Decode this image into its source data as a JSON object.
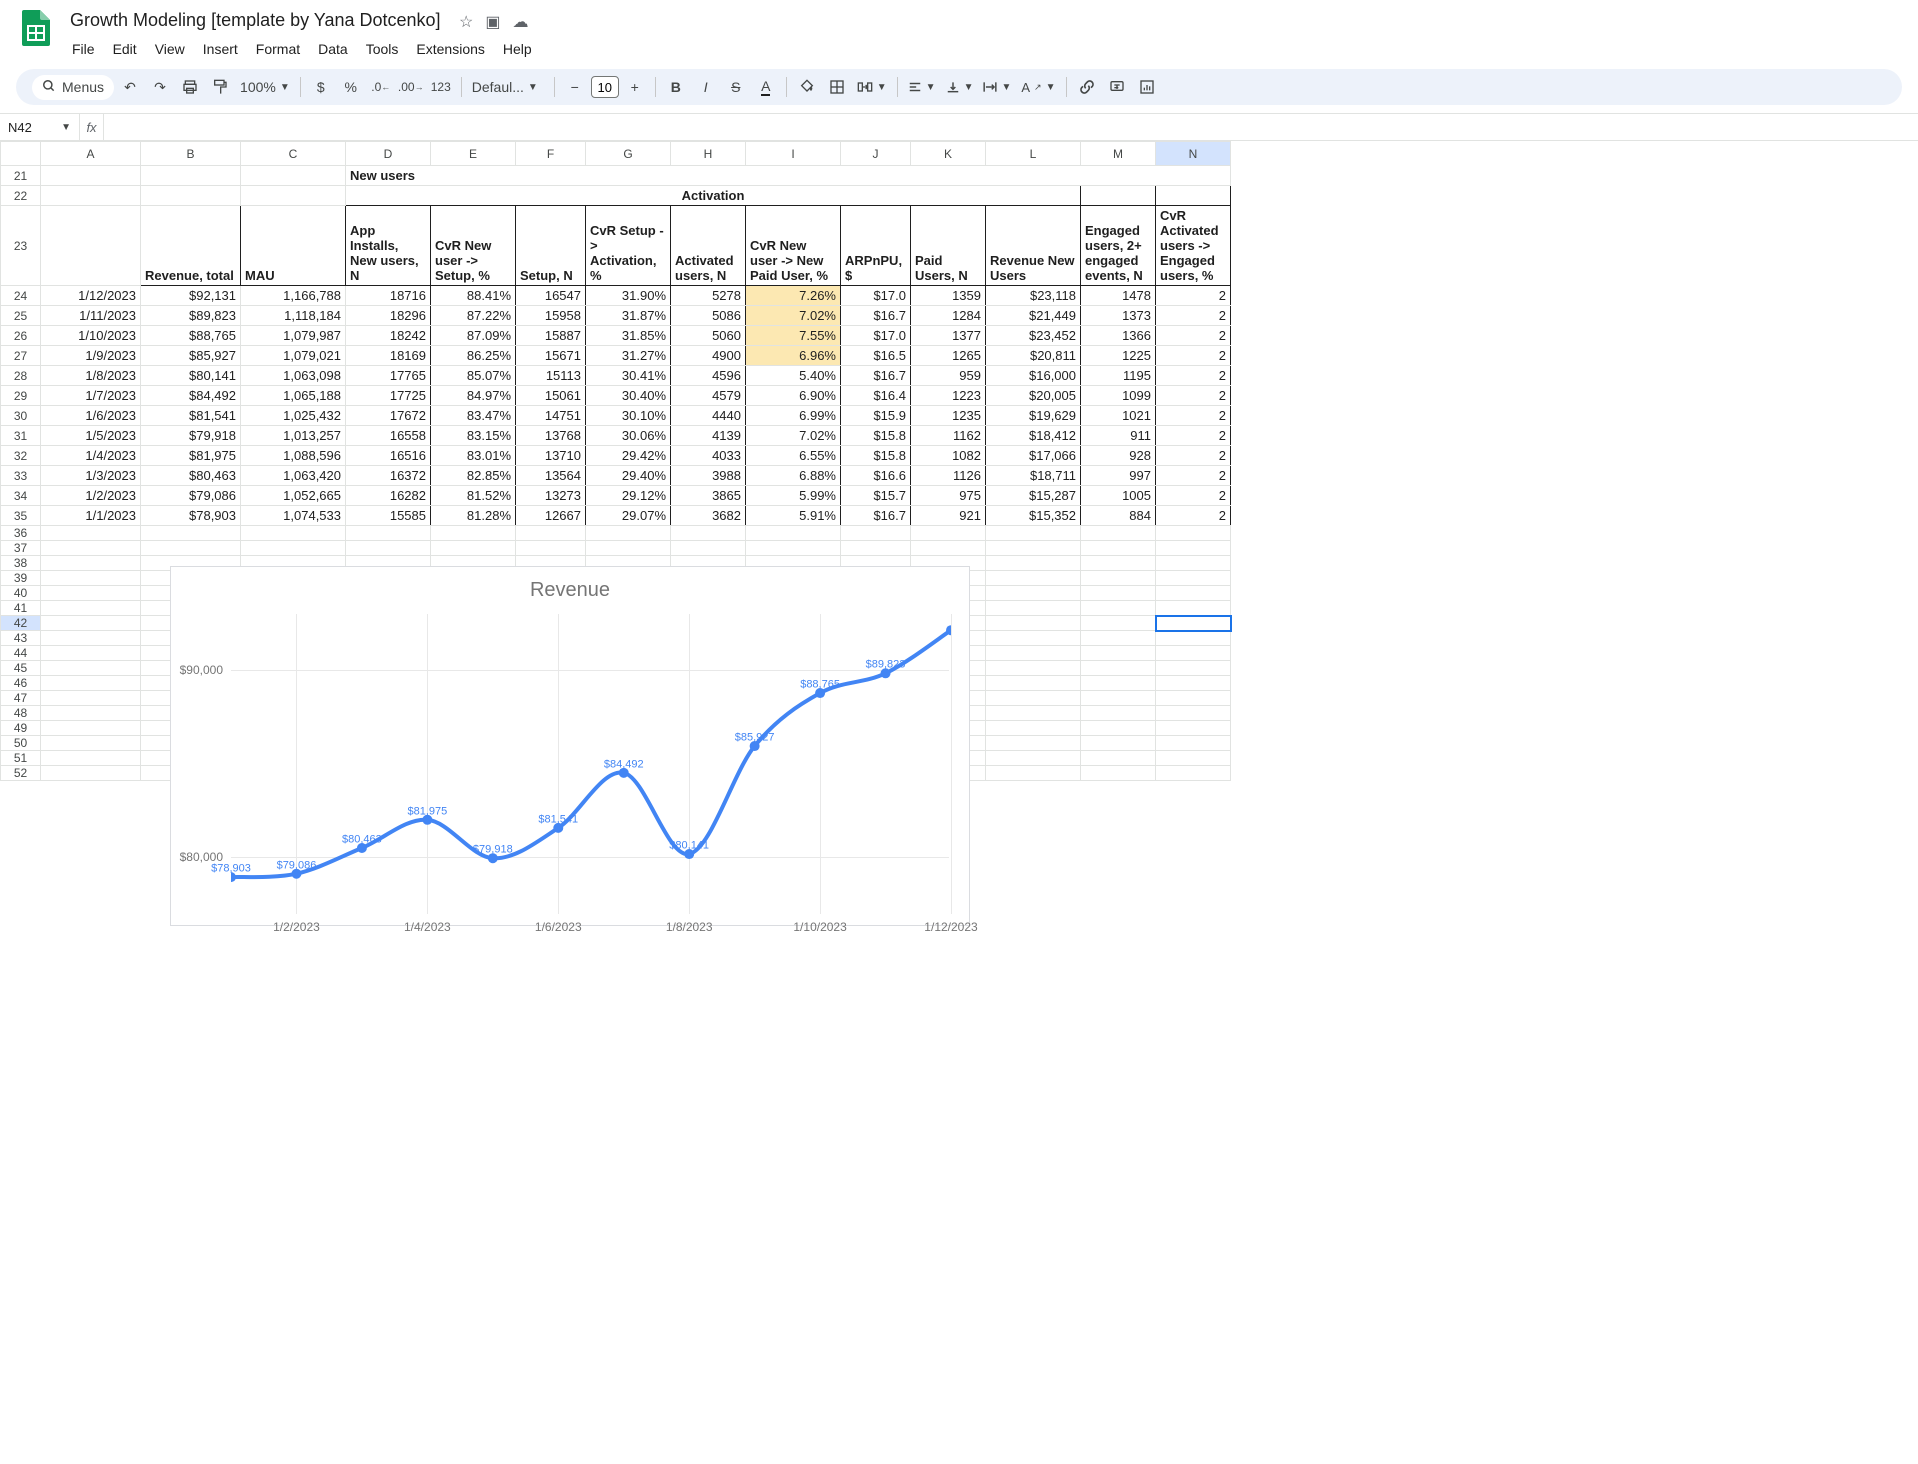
{
  "doc": {
    "title": "Growth Modeling [template by Yana Dotcenko]"
  },
  "menubar": [
    "File",
    "Edit",
    "View",
    "Insert",
    "Format",
    "Data",
    "Tools",
    "Extensions",
    "Help"
  ],
  "toolbar": {
    "search_label": "Menus",
    "zoom": "100%",
    "font": "Defaul...",
    "fontsize": "10",
    "numfmt_123": "123"
  },
  "namebox": "N42",
  "columns": [
    "A",
    "B",
    "C",
    "D",
    "E",
    "F",
    "G",
    "H",
    "I",
    "J",
    "K",
    "L",
    "M",
    "N"
  ],
  "row_start": 21,
  "header_rows": {
    "new_users": "New users",
    "activation": "Activation",
    "labels": {
      "B": "Revenue, total",
      "C": "MAU",
      "D": "App Installs, New users, N",
      "E": "CvR New user -> Setup, %",
      "F": "Setup, N",
      "G": "CvR Setup -> Activation, %",
      "H": "Activated users, N",
      "I": "CvR New user -> New Paid User, %",
      "J": "ARPnPU, $",
      "K": "Paid Users, N",
      "L": "Revenue New Users",
      "M": "Engaged users, 2+ engaged events, N",
      "N": "CvR Activated users -> Engaged users, %"
    }
  },
  "data_rows": [
    {
      "A": "1/12/2023",
      "B": "$92,131",
      "C": "1,166,788",
      "D": "18716",
      "E": "88.41%",
      "F": "16547",
      "G": "31.90%",
      "H": "5278",
      "I": "7.26%",
      "J": "$17.0",
      "K": "1359",
      "L": "$23,118",
      "M": "1478",
      "N": "2",
      "hi": true
    },
    {
      "A": "1/11/2023",
      "B": "$89,823",
      "C": "1,118,184",
      "D": "18296",
      "E": "87.22%",
      "F": "15958",
      "G": "31.87%",
      "H": "5086",
      "I": "7.02%",
      "J": "$16.7",
      "K": "1284",
      "L": "$21,449",
      "M": "1373",
      "N": "2",
      "hi": true
    },
    {
      "A": "1/10/2023",
      "B": "$88,765",
      "C": "1,079,987",
      "D": "18242",
      "E": "87.09%",
      "F": "15887",
      "G": "31.85%",
      "H": "5060",
      "I": "7.55%",
      "J": "$17.0",
      "K": "1377",
      "L": "$23,452",
      "M": "1366",
      "N": "2",
      "hi": true
    },
    {
      "A": "1/9/2023",
      "B": "$85,927",
      "C": "1,079,021",
      "D": "18169",
      "E": "86.25%",
      "F": "15671",
      "G": "31.27%",
      "H": "4900",
      "I": "6.96%",
      "J": "$16.5",
      "K": "1265",
      "L": "$20,811",
      "M": "1225",
      "N": "2",
      "hi": true
    },
    {
      "A": "1/8/2023",
      "B": "$80,141",
      "C": "1,063,098",
      "D": "17765",
      "E": "85.07%",
      "F": "15113",
      "G": "30.41%",
      "H": "4596",
      "I": "5.40%",
      "J": "$16.7",
      "K": "959",
      "L": "$16,000",
      "M": "1195",
      "N": "2"
    },
    {
      "A": "1/7/2023",
      "B": "$84,492",
      "C": "1,065,188",
      "D": "17725",
      "E": "84.97%",
      "F": "15061",
      "G": "30.40%",
      "H": "4579",
      "I": "6.90%",
      "J": "$16.4",
      "K": "1223",
      "L": "$20,005",
      "M": "1099",
      "N": "2"
    },
    {
      "A": "1/6/2023",
      "B": "$81,541",
      "C": "1,025,432",
      "D": "17672",
      "E": "83.47%",
      "F": "14751",
      "G": "30.10%",
      "H": "4440",
      "I": "6.99%",
      "J": "$15.9",
      "K": "1235",
      "L": "$19,629",
      "M": "1021",
      "N": "2"
    },
    {
      "A": "1/5/2023",
      "B": "$79,918",
      "C": "1,013,257",
      "D": "16558",
      "E": "83.15%",
      "F": "13768",
      "G": "30.06%",
      "H": "4139",
      "I": "7.02%",
      "J": "$15.8",
      "K": "1162",
      "L": "$18,412",
      "M": "911",
      "N": "2"
    },
    {
      "A": "1/4/2023",
      "B": "$81,975",
      "C": "1,088,596",
      "D": "16516",
      "E": "83.01%",
      "F": "13710",
      "G": "29.42%",
      "H": "4033",
      "I": "6.55%",
      "J": "$15.8",
      "K": "1082",
      "L": "$17,066",
      "M": "928",
      "N": "2"
    },
    {
      "A": "1/3/2023",
      "B": "$80,463",
      "C": "1,063,420",
      "D": "16372",
      "E": "82.85%",
      "F": "13564",
      "G": "29.40%",
      "H": "3988",
      "I": "6.88%",
      "J": "$16.6",
      "K": "1126",
      "L": "$18,711",
      "M": "997",
      "N": "2"
    },
    {
      "A": "1/2/2023",
      "B": "$79,086",
      "C": "1,052,665",
      "D": "16282",
      "E": "81.52%",
      "F": "13273",
      "G": "29.12%",
      "H": "3865",
      "I": "5.99%",
      "J": "$15.7",
      "K": "975",
      "L": "$15,287",
      "M": "1005",
      "N": "2"
    },
    {
      "A": "1/1/2023",
      "B": "$78,903",
      "C": "1,074,533",
      "D": "15585",
      "E": "81.28%",
      "F": "12667",
      "G": "29.07%",
      "H": "3682",
      "I": "5.91%",
      "J": "$16.7",
      "K": "921",
      "L": "$15,352",
      "M": "884",
      "N": "2"
    }
  ],
  "empty_rows": [
    36,
    37,
    38,
    39,
    40,
    41,
    42,
    43,
    44,
    45,
    46,
    47,
    48,
    49,
    50,
    51,
    52
  ],
  "chart_data": {
    "type": "line",
    "title": "Revenue",
    "xlabel": "",
    "ylabel": "",
    "ylim": [
      78000,
      93000
    ],
    "y_ticks": [
      {
        "v": 80000,
        "label": "$80,000"
      },
      {
        "v": 90000,
        "label": "$90,000"
      }
    ],
    "x_ticks": [
      "1/2/2023",
      "1/4/2023",
      "1/6/2023",
      "1/8/2023",
      "1/10/2023",
      "1/12/2023"
    ],
    "categories": [
      "1/1/2023",
      "1/2/2023",
      "1/3/2023",
      "1/4/2023",
      "1/5/2023",
      "1/6/2023",
      "1/7/2023",
      "1/8/2023",
      "1/9/2023",
      "1/10/2023",
      "1/11/2023",
      "1/12/2023"
    ],
    "values": [
      78903,
      79086,
      80463,
      81975,
      79918,
      81541,
      84492,
      80141,
      85927,
      88765,
      89823,
      92131
    ],
    "labels": [
      "$78,903",
      "$79,086",
      "$80,463",
      "$81,975",
      "$79,918",
      "$81,541",
      "$84,492",
      "$80,141",
      "$85,927",
      "$88,765",
      "$89,823",
      ""
    ]
  }
}
